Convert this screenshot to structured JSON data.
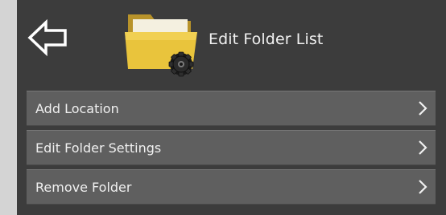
{
  "header": {
    "title": "Edit Folder List",
    "back_icon": "back-arrow-icon",
    "folder_icon": "folder-settings-icon"
  },
  "menu": {
    "items": [
      {
        "label": "Add Location",
        "icon": "chevron-right-icon"
      },
      {
        "label": "Edit Folder Settings",
        "icon": "chevron-right-icon"
      },
      {
        "label": "Remove Folder",
        "icon": "chevron-right-icon"
      }
    ]
  },
  "colors": {
    "background": "#3c3c3c",
    "menu_item": "#5f5f5f",
    "text": "#f0f0f0",
    "folder": "#e7c43a"
  }
}
